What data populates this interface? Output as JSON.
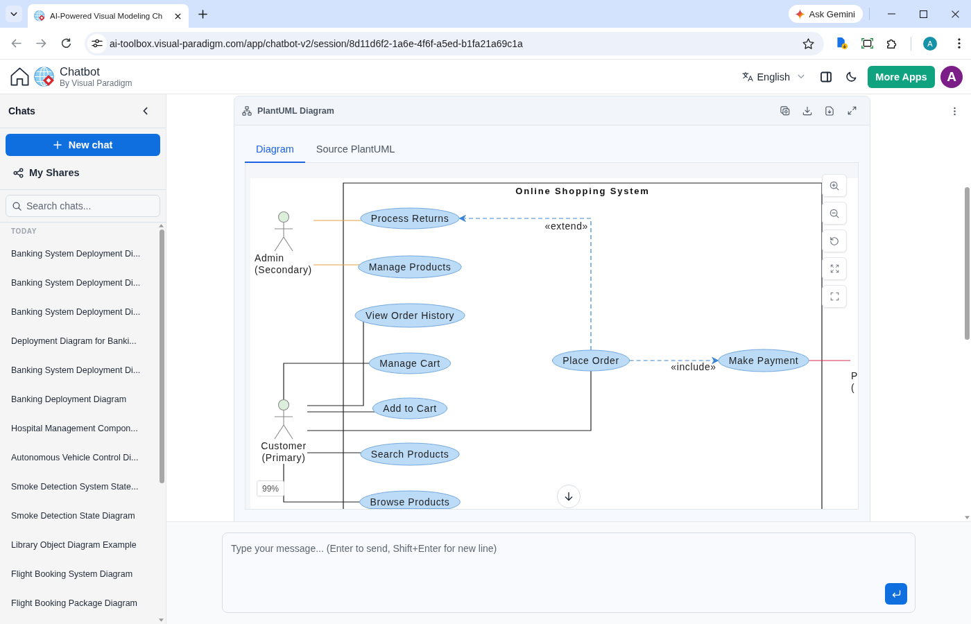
{
  "browser": {
    "tabs": [
      {
        "title": "AI-Powered Visual Modeling Ch",
        "selected": true
      }
    ],
    "gemini_button": "Ask Gemini",
    "url": "ai-toolbox.visual-paradigm.com/app/chatbot-v2/session/8d11d6f2-1a6e-4f6f-a5ed-b1fa21a69c1a",
    "profile_initial": "A"
  },
  "app_header": {
    "title": "Chatbot",
    "subtitle": "By Visual Paradigm",
    "language": "English",
    "more_apps_button": "More Apps",
    "avatar_initial": "A"
  },
  "sidebar": {
    "title": "Chats",
    "new_chat_button": "New chat",
    "my_shares": "My Shares",
    "search": {
      "placeholder": "Search chats..."
    },
    "sections": [
      {
        "label": "TODAY",
        "chats": [
          {
            "title": "Banking System Deployment Di...",
            "selected": false
          },
          {
            "title": "Banking System Deployment Di...",
            "selected": false
          },
          {
            "title": "Banking System Deployment Di...",
            "selected": false
          },
          {
            "title": "Deployment Diagram for Banki...",
            "selected": false
          },
          {
            "title": "Banking System Deployment Di...",
            "selected": false
          },
          {
            "title": "Banking Deployment Diagram",
            "selected": false
          },
          {
            "title": "Hospital Management Compon...",
            "selected": false
          },
          {
            "title": "Autonomous Vehicle Control Di...",
            "selected": false
          },
          {
            "title": "Smoke Detection System State...",
            "selected": false
          },
          {
            "title": "Smoke Detection State Diagram",
            "selected": false
          },
          {
            "title": "Library Object Diagram Example",
            "selected": false
          },
          {
            "title": "Flight Booking System Diagram",
            "selected": false
          },
          {
            "title": "Flight Booking Package Diagram",
            "selected": false
          }
        ]
      }
    ]
  },
  "diagram_panel": {
    "title": "PlantUML Diagram",
    "tabs": [
      {
        "label": "Diagram",
        "selected": true
      },
      {
        "label": "Source PlantUML",
        "selected": false
      }
    ],
    "zoom_level": "99%",
    "diagram": {
      "system": "Online Shopping System",
      "actors": [
        {
          "label": [
            "Admin",
            "(Secondary)"
          ],
          "use_cases": [
            "Process Returns",
            "Manage Products"
          ]
        },
        {
          "label": [
            "Customer",
            "(Primary)"
          ],
          "use_cases": [
            "View Order History",
            "Manage Cart",
            "Add to Cart",
            "Search Products",
            "Browse Products",
            "Place Order"
          ]
        },
        {
          "label": [
            "P",
            "("
          ],
          "use_cases": [
            "Make Payment"
          ]
        }
      ],
      "relations": [
        {
          "label": "«extend»"
        },
        {
          "label": "«include»"
        }
      ]
    }
  },
  "composer": {
    "placeholder": "Type your message... (Enter to send, Shift+Enter for new line)"
  }
}
